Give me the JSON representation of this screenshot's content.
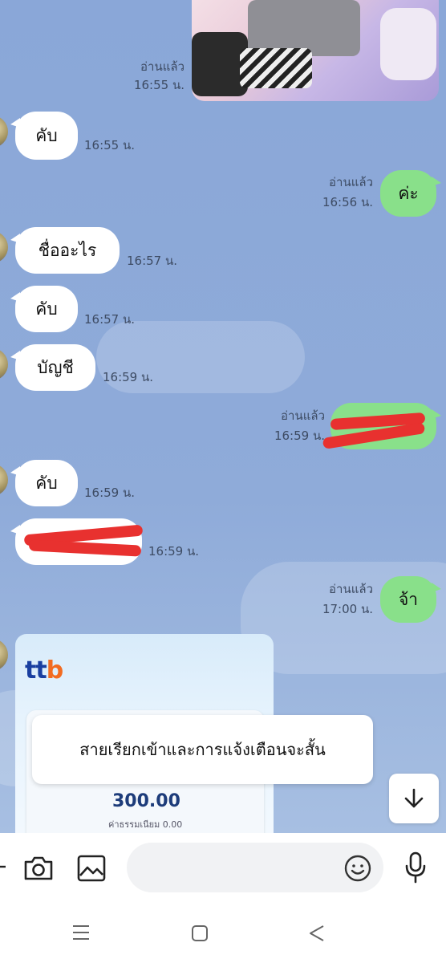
{
  "messages": {
    "photo_read": "อ่านแล้ว",
    "photo_time": "16:55 น.",
    "m1_text": "คับ",
    "m1_time": "16:55 น.",
    "m2_read": "อ่านแล้ว",
    "m2_time": "16:56 น.",
    "m2_text": "ค่ะ",
    "m3_text": "ชื่ออะไร",
    "m3_time": "16:57 น.",
    "m4_text": "คับ",
    "m4_time": "16:57 น.",
    "m5_text": "บัญชี",
    "m5_time": "16:59 น.",
    "m6_read": "อ่านแล้ว",
    "m6_time": "16:59 น.",
    "m7_text": "คับ",
    "m7_time": "16:59 น.",
    "m8_time": "16:59 น.",
    "m9_read": "อ่านแล้ว",
    "m9_time": "17:00 น.",
    "m9_text": "จ้า"
  },
  "slip": {
    "logo_part1": "tt",
    "logo_part2": "b",
    "amount": "300.00",
    "fee_label": "ค่าธรรมเนียม  0.00"
  },
  "toast": {
    "text": "สายเรียกเข้าและการแจ้งเตือนจะสั้น"
  },
  "input": {
    "placeholder": ""
  },
  "colors": {
    "chat_bg": "#8ca9d8",
    "outgoing_bubble": "#89e08a",
    "incoming_bubble": "#ffffff",
    "redaction": "#e8312f"
  },
  "icons": [
    "camera-icon",
    "image-icon",
    "emoji-icon",
    "microphone-icon",
    "arrow-down-icon",
    "nav-menu-icon",
    "nav-home-icon",
    "nav-back-icon"
  ]
}
